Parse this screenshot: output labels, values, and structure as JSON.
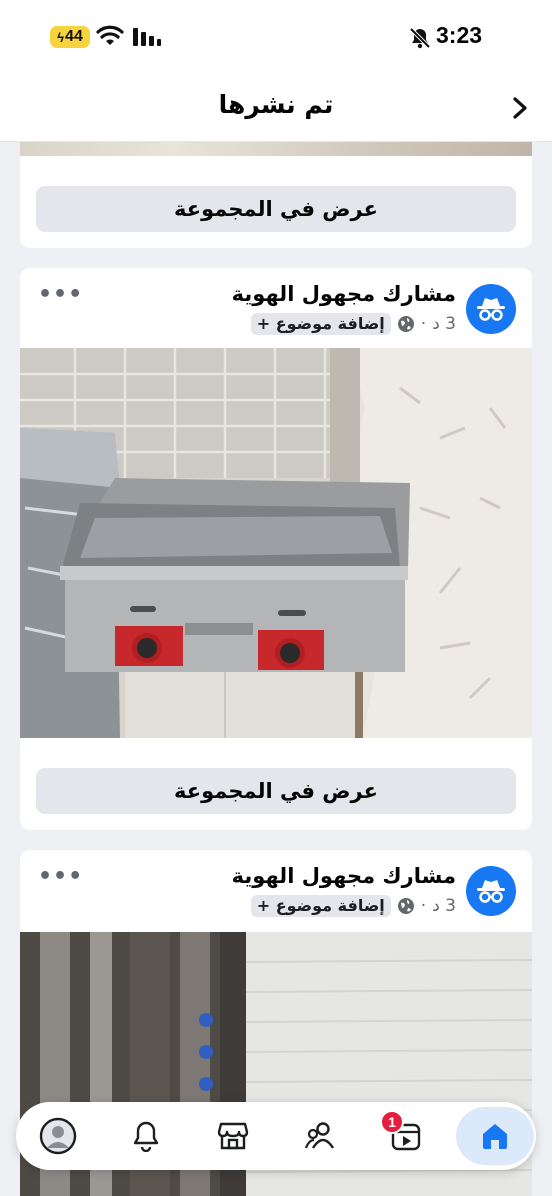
{
  "status_bar": {
    "battery": "44",
    "time": "3:23"
  },
  "header": {
    "title": "تم نشرها"
  },
  "cards": [
    {
      "view_button": "عرض في المجموعة"
    },
    {
      "author": "مشارك مجهول الهوية",
      "time": "3 د",
      "separator": "·",
      "add_topic": "إضافة موضوع +",
      "view_button": "عرض في المجموعة"
    },
    {
      "author": "مشارك مجهول الهوية",
      "time": "3 د",
      "separator": "·",
      "add_topic": "إضافة موضوع +"
    }
  ],
  "tab_bar": {
    "video_badge": "1",
    "items": [
      "profile",
      "notifications",
      "marketplace",
      "friends",
      "video",
      "home"
    ],
    "active": "home"
  },
  "colors": {
    "brand_blue": "#1877f2",
    "badge_red": "#e41e3f"
  }
}
